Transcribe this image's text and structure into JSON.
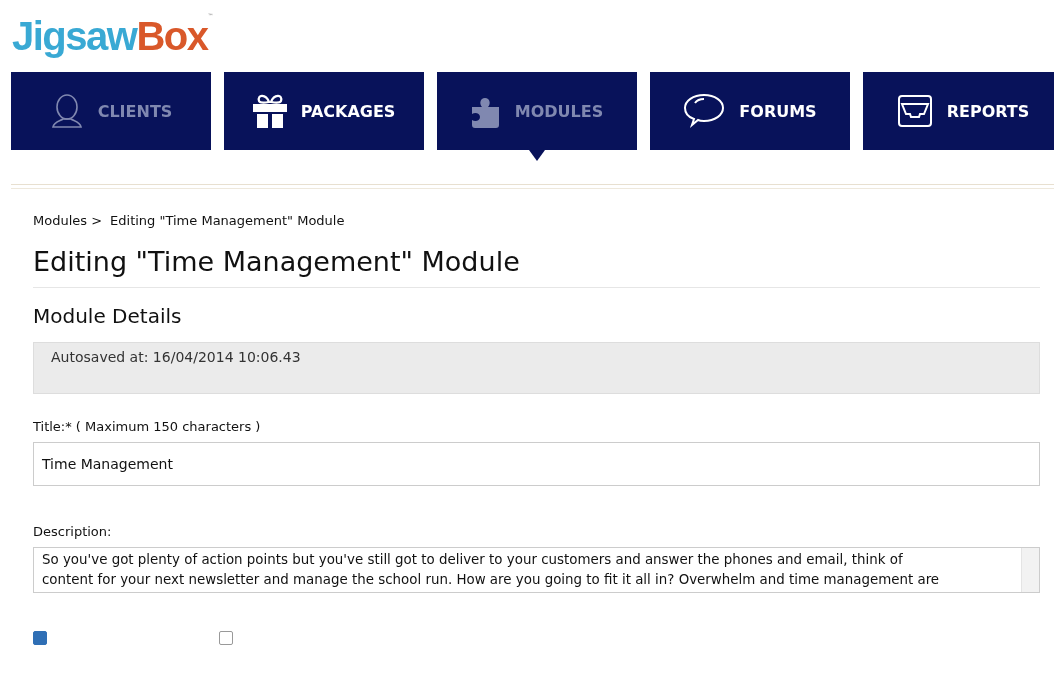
{
  "logo": {
    "part_1": "Jigsaw",
    "part_2": "Box",
    "trademark": "™"
  },
  "nav": [
    {
      "label": "CLIENTS",
      "muted": true,
      "selected": false
    },
    {
      "label": "PACKAGES",
      "muted": false,
      "selected": false
    },
    {
      "label": "MODULES",
      "muted": true,
      "selected": true
    },
    {
      "label": "FORUMS",
      "muted": false,
      "selected": false
    },
    {
      "label": "REPORTS",
      "muted": false,
      "selected": false
    }
  ],
  "breadcrumb": [
    "Modules >",
    "Editing \"Time Management\" Module"
  ],
  "page_title": "Editing \"Time Management\" Module",
  "section_title": "Module Details",
  "autosave": "Autosaved at: 16/04/2014 10:06.43",
  "title_field": {
    "label": "Title:* ( Maximum 150 characters )",
    "value": "Time Management"
  },
  "description_field": {
    "label": "Description:",
    "value": "So you've got plenty of action points but you've still got to deliver to your customers and answer the phones and email, think of content for your next newsletter and manage the school run. How are you going to fit it all in? Overwhelm and time management are"
  },
  "checkboxes": [
    {
      "checked": true
    },
    {
      "checked": false
    }
  ]
}
